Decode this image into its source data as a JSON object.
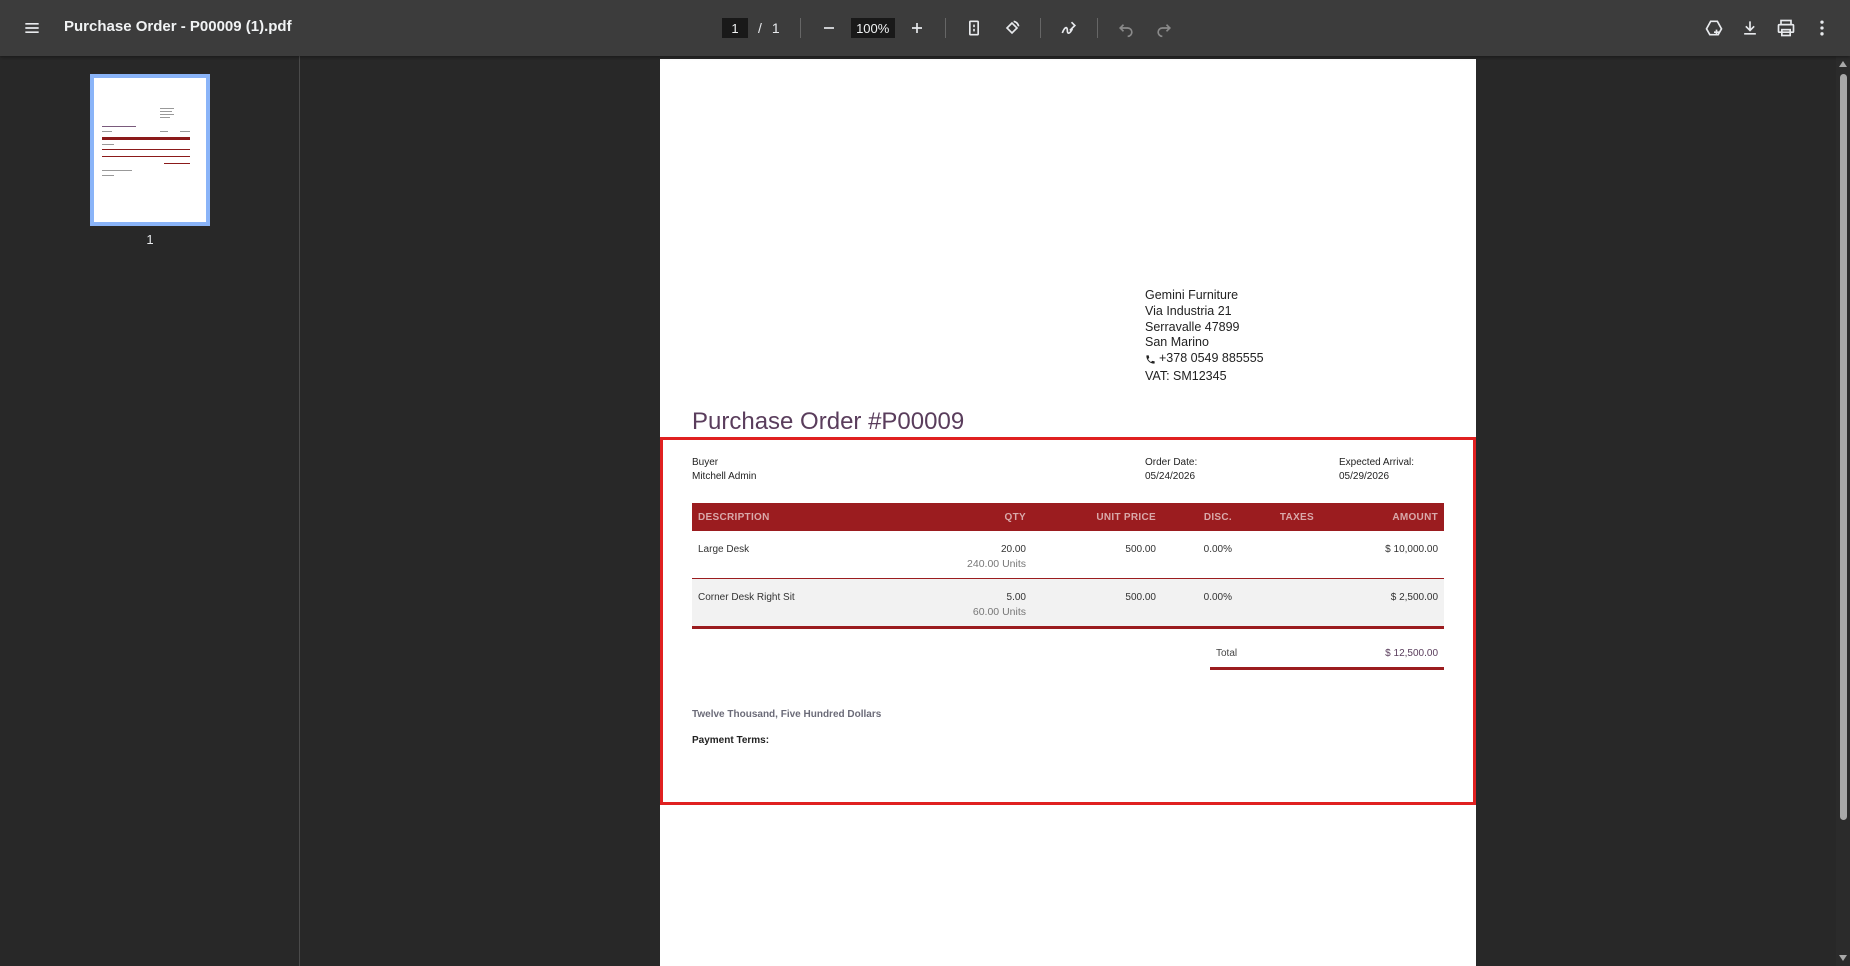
{
  "toolbar": {
    "title": "Purchase Order - P00009 (1).pdf",
    "current_page": "1",
    "page_separator": "/",
    "total_pages": "1",
    "zoom": "100%"
  },
  "sidebar": {
    "thumbnail_label": "1"
  },
  "document": {
    "company": {
      "name": "Gemini Furniture",
      "street": "Via Industria 21",
      "city_zip": "Serravalle 47899",
      "country": "San Marino",
      "phone": "+378 0549 885555",
      "vat": "VAT: SM12345"
    },
    "title": "Purchase Order #P00009",
    "buyer_label": "Buyer",
    "buyer_value": "Mitchell Admin",
    "order_date_label": "Order Date:",
    "order_date_value": "05/24/2026",
    "expected_arrival_label": "Expected Arrival:",
    "expected_arrival_value": "05/29/2026",
    "table": {
      "headers": {
        "description": "DESCRIPTION",
        "qty": "QTY",
        "unit_price": "UNIT PRICE",
        "disc": "DISC.",
        "taxes": "TAXES",
        "amount": "AMOUNT"
      },
      "rows": [
        {
          "description": "Large Desk",
          "qty": "20.00",
          "units": "240.00 Units",
          "unit_price": "500.00",
          "disc": "0.00%",
          "taxes": "",
          "amount": "$ 10,000.00"
        },
        {
          "description": "Corner Desk Right Sit",
          "qty": "5.00",
          "units": "60.00 Units",
          "unit_price": "500.00",
          "disc": "0.00%",
          "taxes": "",
          "amount": "$ 2,500.00"
        }
      ]
    },
    "total_label": "Total",
    "total_value": "$ 12,500.00",
    "amount_in_words": "Twelve Thousand, Five Hundred Dollars",
    "payment_terms_label": "Payment Terms:"
  },
  "colors": {
    "accent": "#9b1c1f",
    "highlight": "#e02020",
    "title": "#5a3d5c"
  }
}
